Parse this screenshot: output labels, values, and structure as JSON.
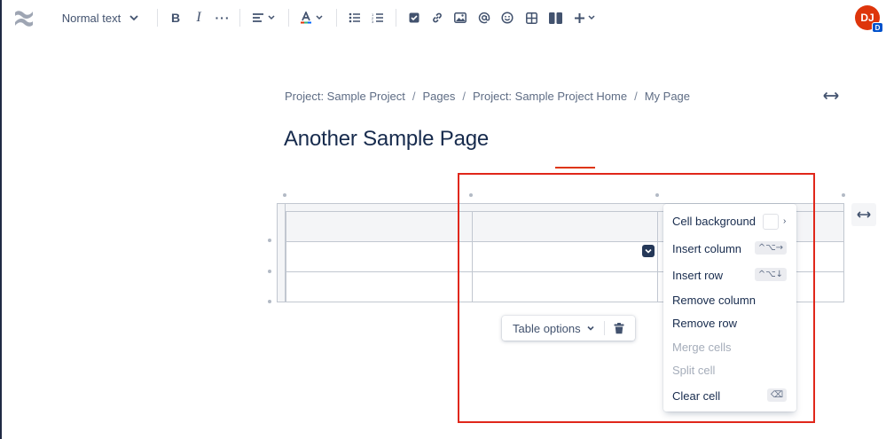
{
  "toolbar": {
    "text_style": "Normal text",
    "more_label": "···"
  },
  "user": {
    "initials": "DJ",
    "badge": "D"
  },
  "breadcrumb": {
    "items": [
      "Project: Sample Project",
      "Pages",
      "Project: Sample Project Home",
      "My Page"
    ],
    "separator": "/"
  },
  "page": {
    "title": "Another Sample Page"
  },
  "table": {
    "columns": 3,
    "rows": [
      "header",
      "body",
      "body"
    ]
  },
  "table_options": {
    "label": "Table options"
  },
  "context_menu": {
    "items": [
      {
        "label": "Cell background",
        "shortcut": "",
        "enabled": true
      },
      {
        "label": "Insert column",
        "shortcut": "^⌥→",
        "enabled": true
      },
      {
        "label": "Insert row",
        "shortcut": "^⌥↓",
        "enabled": true
      },
      {
        "label": "Remove column",
        "shortcut": "",
        "enabled": true
      },
      {
        "label": "Remove row",
        "shortcut": "",
        "enabled": true
      },
      {
        "label": "Merge cells",
        "shortcut": "",
        "enabled": false
      },
      {
        "label": "Split cell",
        "shortcut": "",
        "enabled": false
      },
      {
        "label": "Clear cell",
        "shortcut": "⌫",
        "enabled": true
      }
    ]
  },
  "colors": {
    "avatar": "#de350b",
    "badge": "#0052cc",
    "highlight": "#e0271a",
    "text_primary": "#172b4d",
    "text_disabled": "#a5adba"
  }
}
